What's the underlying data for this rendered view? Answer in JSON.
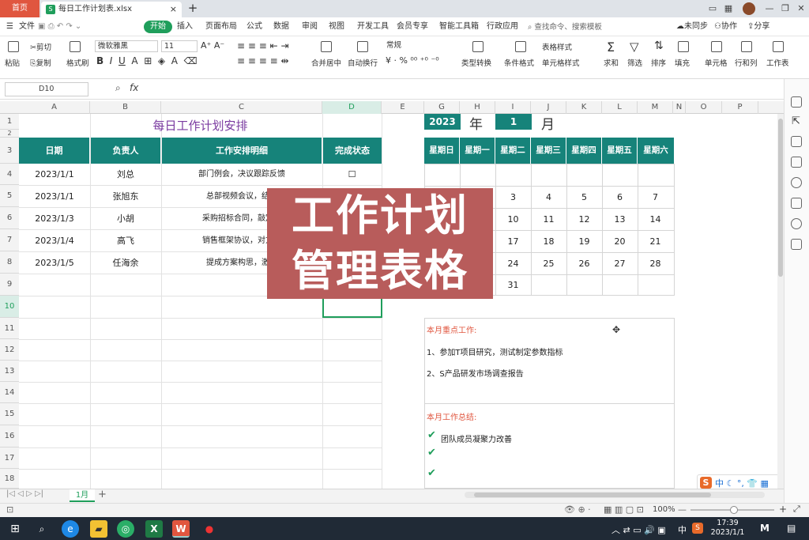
{
  "window": {
    "home_tab": "首页",
    "file_name": "每日工作计划表.xlsx",
    "new_tab": "+"
  },
  "menu": {
    "items": [
      "文件",
      "开始",
      "插入",
      "页面布局",
      "公式",
      "数据",
      "审阅",
      "视图",
      "开发工具",
      "会员专享",
      "智能工具箱",
      "行政应用"
    ],
    "search": "查找命令、搜索模板",
    "sync": "未同步",
    "collab": "协作",
    "share": "分享"
  },
  "ribbon": {
    "paste": "粘贴",
    "cut": "剪切",
    "copy": "复制",
    "format_painter": "格式刷",
    "font_name": "微软雅黑",
    "font_size": "11",
    "merge": "合并居中",
    "wrap": "自动换行",
    "number_format": "常规",
    "type_convert": "类型转换",
    "cond_format": "条件格式",
    "table_style": "表格样式",
    "cell_style": "单元格样式",
    "sum": "求和",
    "filter": "筛选",
    "sort": "排序",
    "fill": "填充",
    "cell": "单元格",
    "row_col": "行和列",
    "worksheet": "工作表"
  },
  "formula": {
    "cell_ref": "D10",
    "fx": "fx"
  },
  "columns": [
    "A",
    "B",
    "C",
    "D",
    "E",
    "G",
    "H",
    "I",
    "J",
    "K",
    "L",
    "M",
    "N",
    "O",
    "P"
  ],
  "rows": [
    "1",
    "2",
    "3",
    "4",
    "5",
    "6",
    "7",
    "8",
    "9",
    "10",
    "11",
    "12",
    "13",
    "14",
    "15",
    "16",
    "17",
    "18"
  ],
  "table": {
    "title": "每日工作计划安排",
    "headers": [
      "日期",
      "负责人",
      "工作安排明细",
      "完成状态"
    ],
    "rows": [
      {
        "date": "2023/1/1",
        "person": "刘总",
        "detail": "部门例会，决议跟踪反馈",
        "status": "☐"
      },
      {
        "date": "2023/1/1",
        "person": "张旭东",
        "detail": "总部视频会议，结果",
        "status": ""
      },
      {
        "date": "2023/1/3",
        "person": "小胡",
        "detail": "采购招标合同，敲定合",
        "status": ""
      },
      {
        "date": "2023/1/4",
        "person": "高飞",
        "detail": "销售框架协议，对方公",
        "status": ""
      },
      {
        "date": "2023/1/5",
        "person": "任海余",
        "detail": "提成方案构思，激励",
        "status": ""
      }
    ]
  },
  "calendar": {
    "year": "2023",
    "year_label": "年",
    "month": "1",
    "month_label": "月",
    "weekdays": [
      "星期日",
      "星期一",
      "星期二",
      "星期三",
      "星期四",
      "星期五",
      "星期六"
    ],
    "rows": [
      [
        "",
        "",
        "",
        "",
        "",
        "",
        ""
      ],
      [
        "",
        "",
        "3",
        "4",
        "5",
        "6",
        "7"
      ],
      [
        "",
        "",
        "10",
        "11",
        "12",
        "13",
        "14"
      ],
      [
        "",
        "",
        "17",
        "18",
        "19",
        "20",
        "21"
      ],
      [
        "",
        "",
        "24",
        "25",
        "26",
        "27",
        "28"
      ],
      [
        "",
        "",
        "31",
        "",
        "",
        "",
        ""
      ]
    ]
  },
  "overlay": {
    "line1": "工作计划",
    "line2": "管理表格"
  },
  "notes": {
    "focus_title": "本月重点工作:",
    "focus_items": [
      "1、参加T项目研究，测试制定参数指标",
      "2、S产品研发市场调查报告"
    ],
    "summary_title": "本月工作总结:",
    "summary_items": [
      "团队成员凝聚力改善",
      "",
      ""
    ]
  },
  "sheet": {
    "tab": "1月",
    "add": "+"
  },
  "status": {
    "zoom": "100%"
  },
  "taskbar": {
    "time": "17:39",
    "date": "2023/1/1",
    "ime": "中"
  },
  "colors": {
    "teal": "#16837a",
    "green": "#1f9e5b",
    "accent": "#e0563f",
    "overlay": "#b85c5b",
    "title": "#7a3aa0"
  }
}
